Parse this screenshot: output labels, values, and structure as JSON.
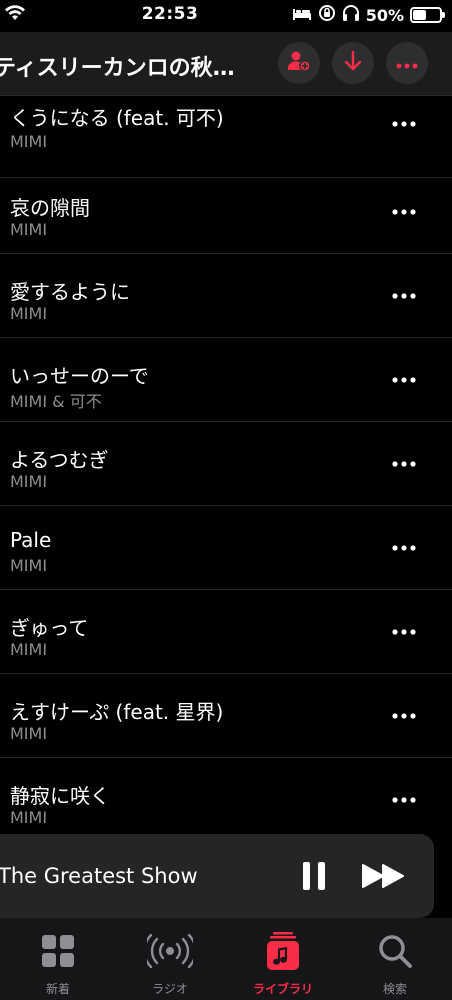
{
  "status_bar": {
    "time": "22:53",
    "battery_percent": "50%",
    "battery_level": 0.5
  },
  "header": {
    "title": "ティスリーカンロの秋…"
  },
  "tracks": [
    {
      "title": "くうになる (feat. 可不)",
      "artist": "MIMI"
    },
    {
      "title": "哀の隙間",
      "artist": "MIMI"
    },
    {
      "title": "愛するように",
      "artist": "MIMI"
    },
    {
      "title": "いっせーのーで",
      "artist": "MIMI & 可不"
    },
    {
      "title": "よるつむぎ",
      "artist": "MIMI"
    },
    {
      "title": "Pale",
      "artist": "MIMI"
    },
    {
      "title": "ぎゅって",
      "artist": "MIMI"
    },
    {
      "title": "えすけーぷ (feat. 星界)",
      "artist": "MIMI"
    },
    {
      "title": "静寂に咲く",
      "artist": "MIMI"
    }
  ],
  "mini_player": {
    "title": "The Greatest Show"
  },
  "tabs": [
    {
      "label": "新着",
      "icon": "grid-icon",
      "active": false
    },
    {
      "label": "ラジオ",
      "icon": "radio-icon",
      "active": false
    },
    {
      "label": "ライブラリ",
      "icon": "library-icon",
      "active": true
    },
    {
      "label": "検索",
      "icon": "search-icon",
      "active": false
    }
  ],
  "colors": {
    "accent": "#fa2d48",
    "background": "#000000",
    "secondary_text": "#8e8e93"
  }
}
